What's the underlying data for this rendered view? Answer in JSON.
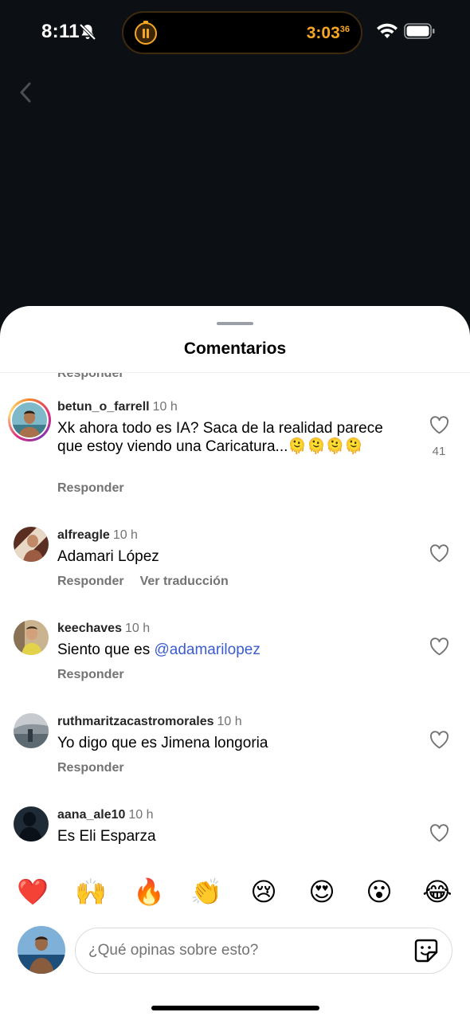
{
  "status_bar": {
    "time": "8:11",
    "timer_main": "3:03",
    "timer_sub": "36",
    "icons": [
      "bell-slash-icon",
      "pause-icon",
      "wifi-icon",
      "battery-icon"
    ]
  },
  "sheet": {
    "title": "Comentarios",
    "partial_reply_label": "Responder"
  },
  "comments": [
    {
      "username": "betun_o_farrell",
      "time_ago": "10 h",
      "text": "Xk ahora todo es IA? Saca de la realidad parece que estoy viendo una Caricatura...🫠🫠🫠🫠",
      "likes": "41",
      "reply_label": "Responder",
      "has_story_ring": true
    },
    {
      "username": "alfreagle",
      "time_ago": "10 h",
      "text": "Adamari López",
      "reply_label": "Responder",
      "translate_label": "Ver traducción"
    },
    {
      "username": "keechaves",
      "time_ago": "10 h",
      "text_prefix": "Siento que es ",
      "mention": "@adamarilopez",
      "reply_label": "Responder"
    },
    {
      "username": "ruthmaritzacastromorales",
      "time_ago": "10 h",
      "text": "Yo digo que es Jimena longoria",
      "reply_label": "Responder"
    },
    {
      "username": "aana_ale10",
      "time_ago": "10 h",
      "text": "Es Eli Esparza"
    }
  ],
  "emoji_reactions": [
    "❤️",
    "🙌",
    "🔥",
    "👏",
    "😢",
    "😍",
    "😮",
    "😂"
  ],
  "composer": {
    "placeholder": "¿Qué opinas sobre esto?",
    "sticker_icon": "sticker-icon"
  },
  "colors": {
    "background_dark": "#0c1014",
    "timer_accent": "#f5a623",
    "mention": "#3b5ccf",
    "secondary_text": "#737373"
  }
}
